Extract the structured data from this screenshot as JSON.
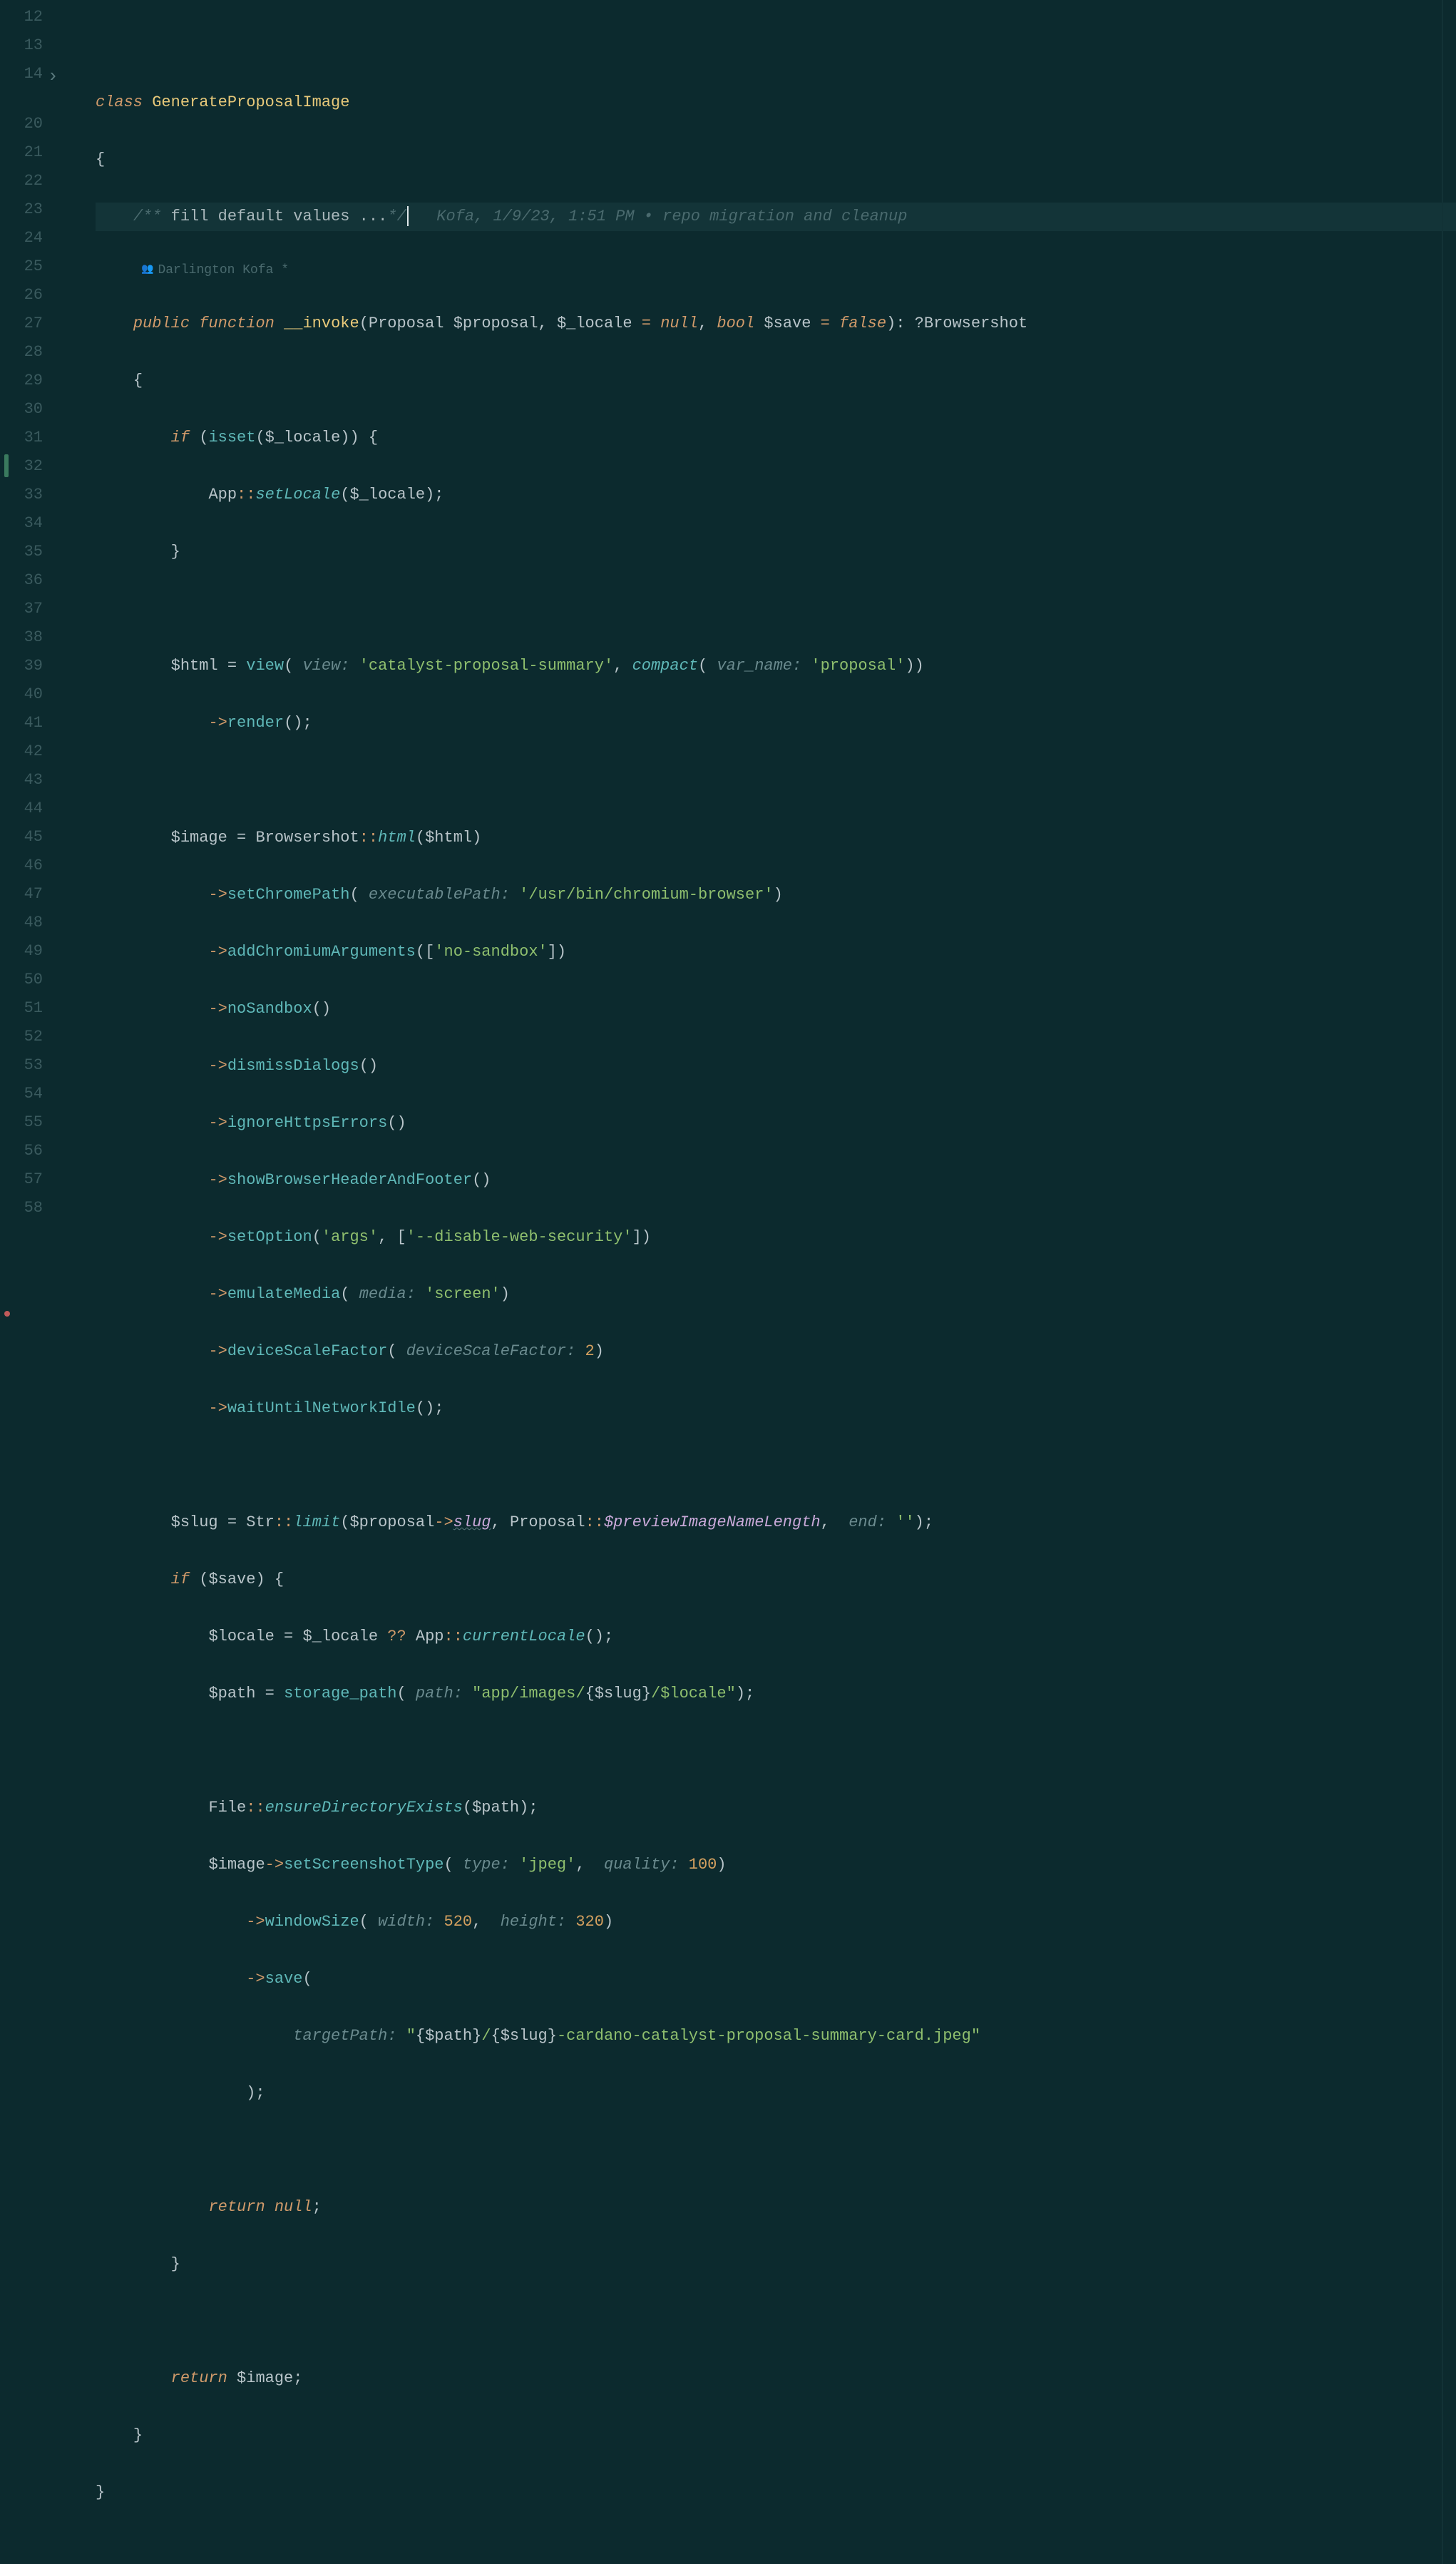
{
  "gutter": [
    "12",
    "13",
    "14",
    "20",
    "21",
    "22",
    "23",
    "24",
    "25",
    "26",
    "27",
    "28",
    "29",
    "30",
    "31",
    "32",
    "33",
    "34",
    "35",
    "36",
    "37",
    "38",
    "39",
    "40",
    "41",
    "42",
    "43",
    "44",
    "45",
    "46",
    "47",
    "48",
    "49",
    "50",
    "51",
    "52",
    "53",
    "54",
    "55",
    "56",
    "57",
    "58"
  ],
  "fold_lines": [
    "14"
  ],
  "author": {
    "icon": "👥",
    "name": "Darlington Kofa *"
  },
  "t": {
    "class": "class",
    "GenerateProposalImage": "GenerateProposalImage",
    "obrace": "{",
    "cbrace": "}",
    "cmt_open": "/**",
    "cmt_text": "fill default values ...",
    "cmt_close": "*/",
    "blame": "Kofa, 1/9/23, 1:51 PM • repo migration and cleanup",
    "public": "public",
    "function": "function",
    "invoke": "__invoke",
    "Proposal": "Proposal",
    "p_proposal": "$proposal",
    "p_locale": "$_locale",
    "eq": " = ",
    "null": "null",
    "bool": "bool",
    "p_save": "$save",
    "false": "false",
    "qBrowsershot": "?Browsershot",
    "if": "if",
    "isset": "isset",
    "App": "App",
    "setLocale": "setLocale",
    "html_v": "$html",
    "view": "view",
    "h_view": "view:",
    "s_view": "'catalyst-proposal-summary'",
    "compact": "compact",
    "h_varname": "var_name:",
    "s_proposal": "'proposal'",
    "render": "render",
    "image_v": "$image",
    "Browsershot": "Browsershot",
    "html_m": "html",
    "setChromePath": "setChromePath",
    "h_exec": "executablePath:",
    "s_exec": "'/usr/bin/chromium-browser'",
    "addChromiumArguments": "addChromiumArguments",
    "s_nosand": "'no-sandbox'",
    "noSandbox": "noSandbox",
    "dismissDialogs": "dismissDialogs",
    "ignoreHttpsErrors": "ignoreHttpsErrors",
    "showBrowserHeaderAndFooter": "showBrowserHeaderAndFooter",
    "setOption": "setOption",
    "s_args": "'args'",
    "s_disable": "'--disable-web-security'",
    "emulateMedia": "emulateMedia",
    "h_media": "media:",
    "s_screen": "'screen'",
    "deviceScaleFactor": "deviceScaleFactor",
    "h_dsf": "deviceScaleFactor:",
    "n2": "2",
    "waitUntilNetworkIdle": "waitUntilNetworkIdle",
    "slug_v": "$slug",
    "Str": "Str",
    "limit": "limit",
    "slug": "slug",
    "Proposal2": "Proposal",
    "previewImageNameLength": "$previewImageNameLength",
    "h_end": "end:",
    "s_empty": "''",
    "locale_v": "$locale",
    "qq": "??",
    "currentLocale": "currentLocale",
    "path_v": "$path",
    "storage_path": "storage_path",
    "h_path": "path:",
    "s_path1": "\"app/images/",
    "s_path2": "/$locale\"",
    "File": "File",
    "ensureDirectoryExists": "ensureDirectoryExists",
    "setScreenshotType": "setScreenshotType",
    "h_type": "type:",
    "s_jpeg": "'jpeg'",
    "h_quality": "quality:",
    "n100": "100",
    "windowSize": "windowSize",
    "h_width": "width:",
    "n520": "520",
    "h_height": "height:",
    "n320": "320",
    "save": "save",
    "h_target": "targetPath:",
    "s_tp1": "\"",
    "s_tp2": "/",
    "s_tp3": "-cardano-catalyst-proposal-summary-card.jpeg\"",
    "return": "return",
    "arrow": "->",
    "scope": "::"
  }
}
